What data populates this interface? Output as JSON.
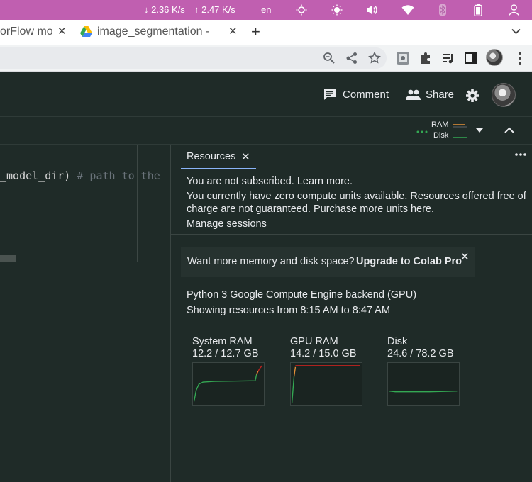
{
  "os_bar": {
    "net_down": "↓ 2.36 K/s",
    "net_up": "↑ 2.47 K/s",
    "lang": "en"
  },
  "tabs": [
    {
      "title": "orFlow mo"
    },
    {
      "title": "image_segmentation - "
    }
  ],
  "colab_header": {
    "comment_label": "Comment",
    "share_label": "Share"
  },
  "toolbar": {
    "ram_label": "RAM",
    "disk_label": "Disk"
  },
  "code": {
    "text": "_model_dir)",
    "comment": "# path to the"
  },
  "resources": {
    "tab_label": "Resources",
    "not_subscribed": "You are not subscribed. Learn more.",
    "compute_units_line1": "You currently have zero compute units available. Resources offered free of",
    "compute_units_line2": "charge are not guaranteed. Purchase more units here.",
    "manage_sessions": "Manage sessions",
    "promo_text": "Want more memory and disk space?",
    "promo_link": "Upgrade to Colab Pro",
    "backend": "Python 3 Google Compute Engine backend (GPU)",
    "time_range": "Showing resources from 8:15 AM to 8:47 AM",
    "metrics": [
      {
        "label": "System RAM",
        "value": "12.2 / 12.7 GB",
        "fraction": 0.96
      },
      {
        "label": "GPU RAM",
        "value": "14.2 / 15.0 GB",
        "fraction": 0.95
      },
      {
        "label": "Disk",
        "value": "24.6 / 78.2 GB",
        "fraction": 0.31
      }
    ]
  },
  "colors": {
    "os_bar": "#c05fb0",
    "colab_bg": "#1f2b28",
    "accent_blue": "#8ab4f8",
    "ram_line": "#34a853",
    "ram_high": "#e69138",
    "gpu_high": "#c5221f"
  }
}
